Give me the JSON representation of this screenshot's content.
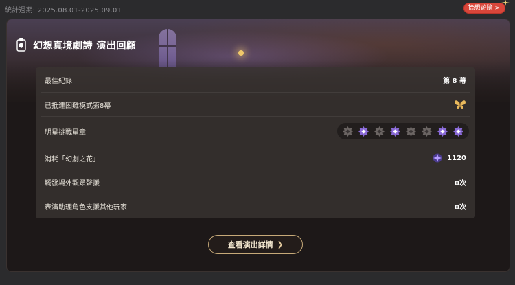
{
  "topbar": {
    "stat_period": "統計週期: 2025.08.01-2025.09.01",
    "share_label": "拾想遊隨",
    "share_arrow": ">"
  },
  "card": {
    "title": "幻想真境劇詩 演出回顧",
    "rows": [
      {
        "label": "最佳紀錄",
        "value": "第 8 幕"
      },
      {
        "label": "已抵達困難模式第8幕",
        "icon": "butterfly-icon"
      },
      {
        "label": "明星挑戰星章",
        "stars": [
          false,
          true,
          false,
          true,
          false,
          false,
          true,
          true
        ]
      },
      {
        "label": "消耗「幻劇之花」",
        "value": "1120",
        "icon": "fantasia-flower-icon"
      },
      {
        "label": "觸發場外觀眾聲援",
        "value": "0次"
      },
      {
        "label": "表演助理角色支援其他玩家",
        "value": "0次"
      }
    ],
    "cta_label": "查看演出詳情",
    "cta_arrow": "❯"
  },
  "colors": {
    "accent_gold": "#c6a978",
    "star_active": "#8a6ad8",
    "star_inactive": "#6b6563",
    "share_red": "#d9463a"
  }
}
